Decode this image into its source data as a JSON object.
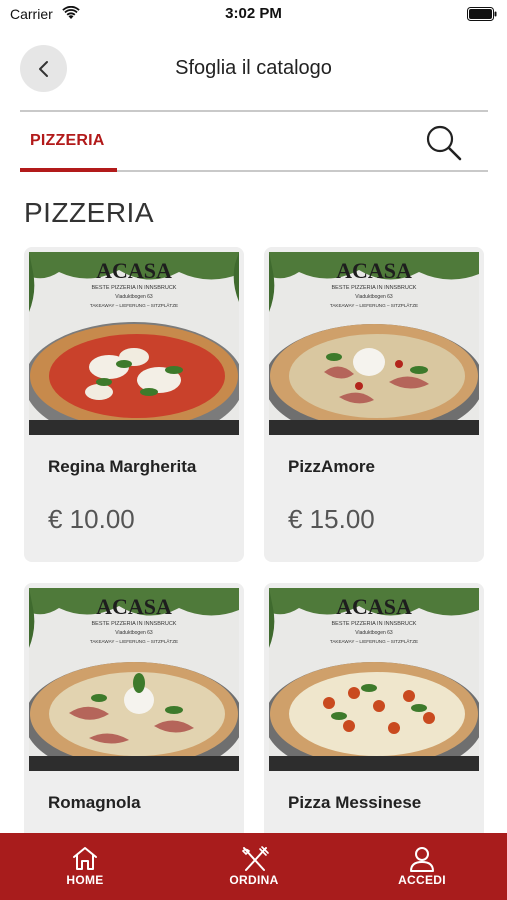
{
  "status_bar": {
    "carrier": "Carrier",
    "time": "3:02 PM",
    "icons": [
      "wifi-icon",
      "battery-icon"
    ]
  },
  "header": {
    "title": "Sfoglia il catalogo",
    "back_icon": "chevron-left-icon"
  },
  "tabs": [
    {
      "label": "PIZZERIA",
      "active": true
    }
  ],
  "search_icon": "search-icon",
  "section": {
    "title": "PIZZERIA"
  },
  "products": [
    {
      "name": "Regina Margherita",
      "price": "€ 10.00",
      "image_text": {
        "brand": "ACASA",
        "tagline": "BESTE PIZZERIA IN INNSBRUCK",
        "address": "Viaduktbogen 63",
        "services": "TAKEAWAY – LIEFERUNG – SITZPLÄTZE"
      }
    },
    {
      "name": "PizzAmore",
      "price": "€ 15.00",
      "image_text": {
        "brand": "ACASA",
        "tagline": "BESTE PIZZERIA IN INNSBRUCK",
        "address": "Viaduktbogen 63",
        "services": "TAKEAWAY – LIEFERUNG – SITZPLÄTZE"
      }
    },
    {
      "name": "Romagnola",
      "price": "",
      "image_text": {
        "brand": "ACASA",
        "tagline": "BESTE PIZZERIA IN INNSBRUCK",
        "address": "Viaduktbogen 63",
        "services": "TAKEAWAY – LIEFERUNG – SITZPLÄTZE"
      }
    },
    {
      "name": "Pizza Messinese",
      "price": "",
      "image_text": {
        "brand": "ACASA",
        "tagline": "BESTE PIZZERIA IN INNSBRUCK",
        "address": "Viaduktbogen 63",
        "services": "TAKEAWAY – LIEFERUNG – SITZPLÄTZE"
      }
    }
  ],
  "bottom_nav": [
    {
      "label": "HOME",
      "icon": "home-icon"
    },
    {
      "label": "ORDINA",
      "icon": "fork-knife-icon"
    },
    {
      "label": "ACCEDI",
      "icon": "user-icon"
    }
  ],
  "colors": {
    "accent": "#b21a1a",
    "nav_background": "#a81c1c",
    "card_background": "#eeeeee"
  }
}
